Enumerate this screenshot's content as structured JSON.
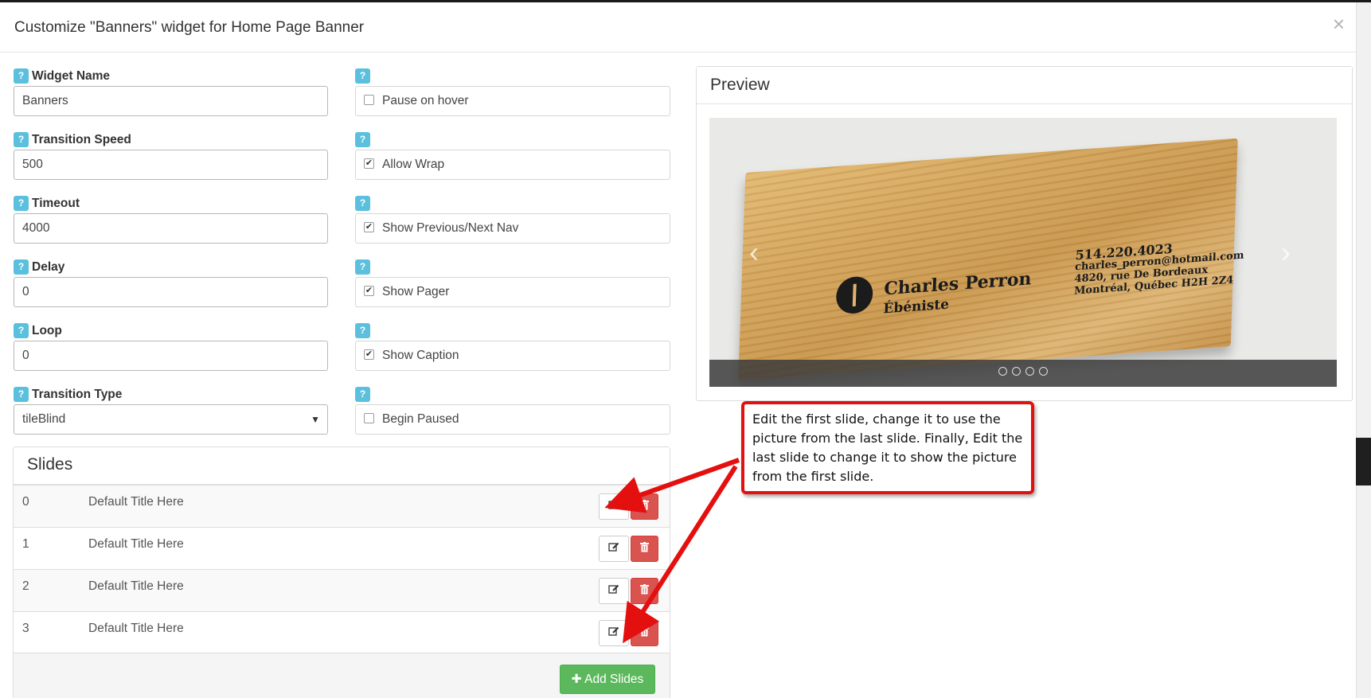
{
  "modal": {
    "title": "Customize \"Banners\" widget for Home Page Banner",
    "close_symbol": "×"
  },
  "left_fields": [
    {
      "label": "Widget Name",
      "value": "Banners",
      "kind": "text"
    },
    {
      "label": "Transition Speed",
      "value": "500",
      "kind": "text"
    },
    {
      "label": "Timeout",
      "value": "4000",
      "kind": "text"
    },
    {
      "label": "Delay",
      "value": "0",
      "kind": "text"
    },
    {
      "label": "Loop",
      "value": "0",
      "kind": "text"
    },
    {
      "label": "Transition Type",
      "value": "tileBlind",
      "kind": "select"
    }
  ],
  "help_badge": "?",
  "checkboxes": [
    {
      "label": "Pause on hover",
      "checked": false
    },
    {
      "label": "Allow Wrap",
      "checked": true
    },
    {
      "label": "Show Previous/Next Nav",
      "checked": true
    },
    {
      "label": "Show Pager",
      "checked": true
    },
    {
      "label": "Show Caption",
      "checked": true
    },
    {
      "label": "Begin Paused",
      "checked": false
    }
  ],
  "preview": {
    "heading": "Preview",
    "card": {
      "name": "Charles Perron",
      "subtitle": "Ébéniste",
      "phone": "514.220.4023",
      "email": "charles_perron@hotmail.com",
      "address_line1": "4820, rue De Bordeaux",
      "address_line2": "Montréal, Québec H2H 2Z4"
    },
    "prev_arrow": "‹",
    "next_arrow": "›",
    "pager_count": 4
  },
  "slides": {
    "heading": "Slides",
    "rows": [
      {
        "num": "0",
        "title": "Default Title Here"
      },
      {
        "num": "1",
        "title": "Default Title Here"
      },
      {
        "num": "2",
        "title": "Default Title Here"
      },
      {
        "num": "3",
        "title": "Default Title Here"
      }
    ],
    "add_label": "Add Slides"
  },
  "callout": {
    "text": "Edit the first slide, change it to use the picture from the last slide. Finally, Edit the last slide to change it to show the picture from the first slide."
  },
  "colors": {
    "info_badge": "#5bc0de",
    "danger": "#d9534f",
    "success": "#5cb85c",
    "callout_red": "#e40f0f"
  }
}
